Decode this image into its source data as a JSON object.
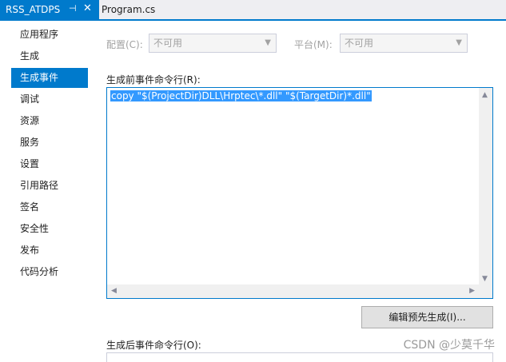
{
  "tabs": {
    "active_title": "RSS_ATDPS",
    "pin_glyph": "⊣",
    "close_glyph": "✕",
    "inactive_title": "Program.cs"
  },
  "nav": {
    "items": [
      "应用程序",
      "生成",
      "生成事件",
      "调试",
      "资源",
      "服务",
      "设置",
      "引用路径",
      "签名",
      "安全性",
      "发布",
      "代码分析"
    ],
    "active_index": 2
  },
  "config": {
    "config_label": "配置(C):",
    "config_value": "不可用",
    "platform_label": "平台(M):",
    "platform_value": "不可用",
    "enabled": false
  },
  "prebuild": {
    "label": "生成前事件命令行(R):",
    "command": "copy \"$(ProjectDir)DLL\\Hrptec\\*.dll\" \"$(TargetDir)*.dll\"",
    "edit_button": "编辑预先生成(I)..."
  },
  "postbuild": {
    "label": "生成后事件命令行(O):"
  },
  "watermark": "CSDN @少莫千华",
  "colors": {
    "accent": "#007acc",
    "selection": "#3399ff"
  }
}
